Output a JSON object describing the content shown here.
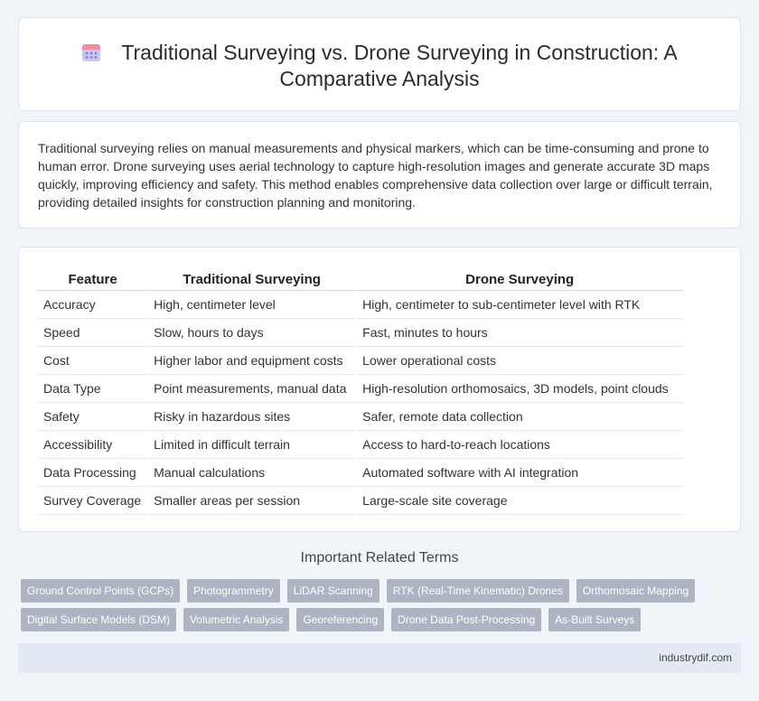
{
  "header": {
    "title": "Traditional Surveying vs. Drone Surveying in Construction: A Comparative Analysis",
    "icon": "calendar-icon"
  },
  "intro": {
    "text": "Traditional surveying relies on manual measurements and physical markers, which can be time-consuming and prone to human error. Drone surveying uses aerial technology to capture high-resolution images and generate accurate 3D maps quickly, improving efficiency and safety. This method enables comprehensive data collection over large or difficult terrain, providing detailed insights for construction planning and monitoring."
  },
  "table": {
    "headers": [
      "Feature",
      "Traditional Surveying",
      "Drone Surveying"
    ],
    "rows": [
      [
        "Accuracy",
        "High, centimeter level",
        "High, centimeter to sub-centimeter level with RTK"
      ],
      [
        "Speed",
        "Slow, hours to days",
        "Fast, minutes to hours"
      ],
      [
        "Cost",
        "Higher labor and equipment costs",
        "Lower operational costs"
      ],
      [
        "Data Type",
        "Point measurements, manual data",
        "High-resolution orthomosaics, 3D models, point clouds"
      ],
      [
        "Safety",
        "Risky in hazardous sites",
        "Safer, remote data collection"
      ],
      [
        "Accessibility",
        "Limited in difficult terrain",
        "Access to hard-to-reach locations"
      ],
      [
        "Data Processing",
        "Manual calculations",
        "Automated software with AI integration"
      ],
      [
        "Survey Coverage",
        "Smaller areas per session",
        "Large-scale site coverage"
      ]
    ]
  },
  "related": {
    "title": "Important Related Terms",
    "row1": [
      "Ground Control Points (GCPs)",
      "Photogrammetry",
      "LiDAR Scanning",
      "RTK (Real-Time Kinematic) Drones",
      "Orthomosaic Mapping"
    ],
    "row2": [
      "Digital Surface Models (DSM)",
      "Volumetric Analysis",
      "Georeferencing",
      "Drone Data Post-Processing",
      "As-Built Surveys"
    ]
  },
  "footer": {
    "text": "industrydif.com"
  },
  "colors": {
    "background": "#f1f4f9",
    "tag": "#adb5c2",
    "footer": "#e4eaf4",
    "icon_header": "#f17fa0",
    "icon_body": "#b9b5f0"
  }
}
